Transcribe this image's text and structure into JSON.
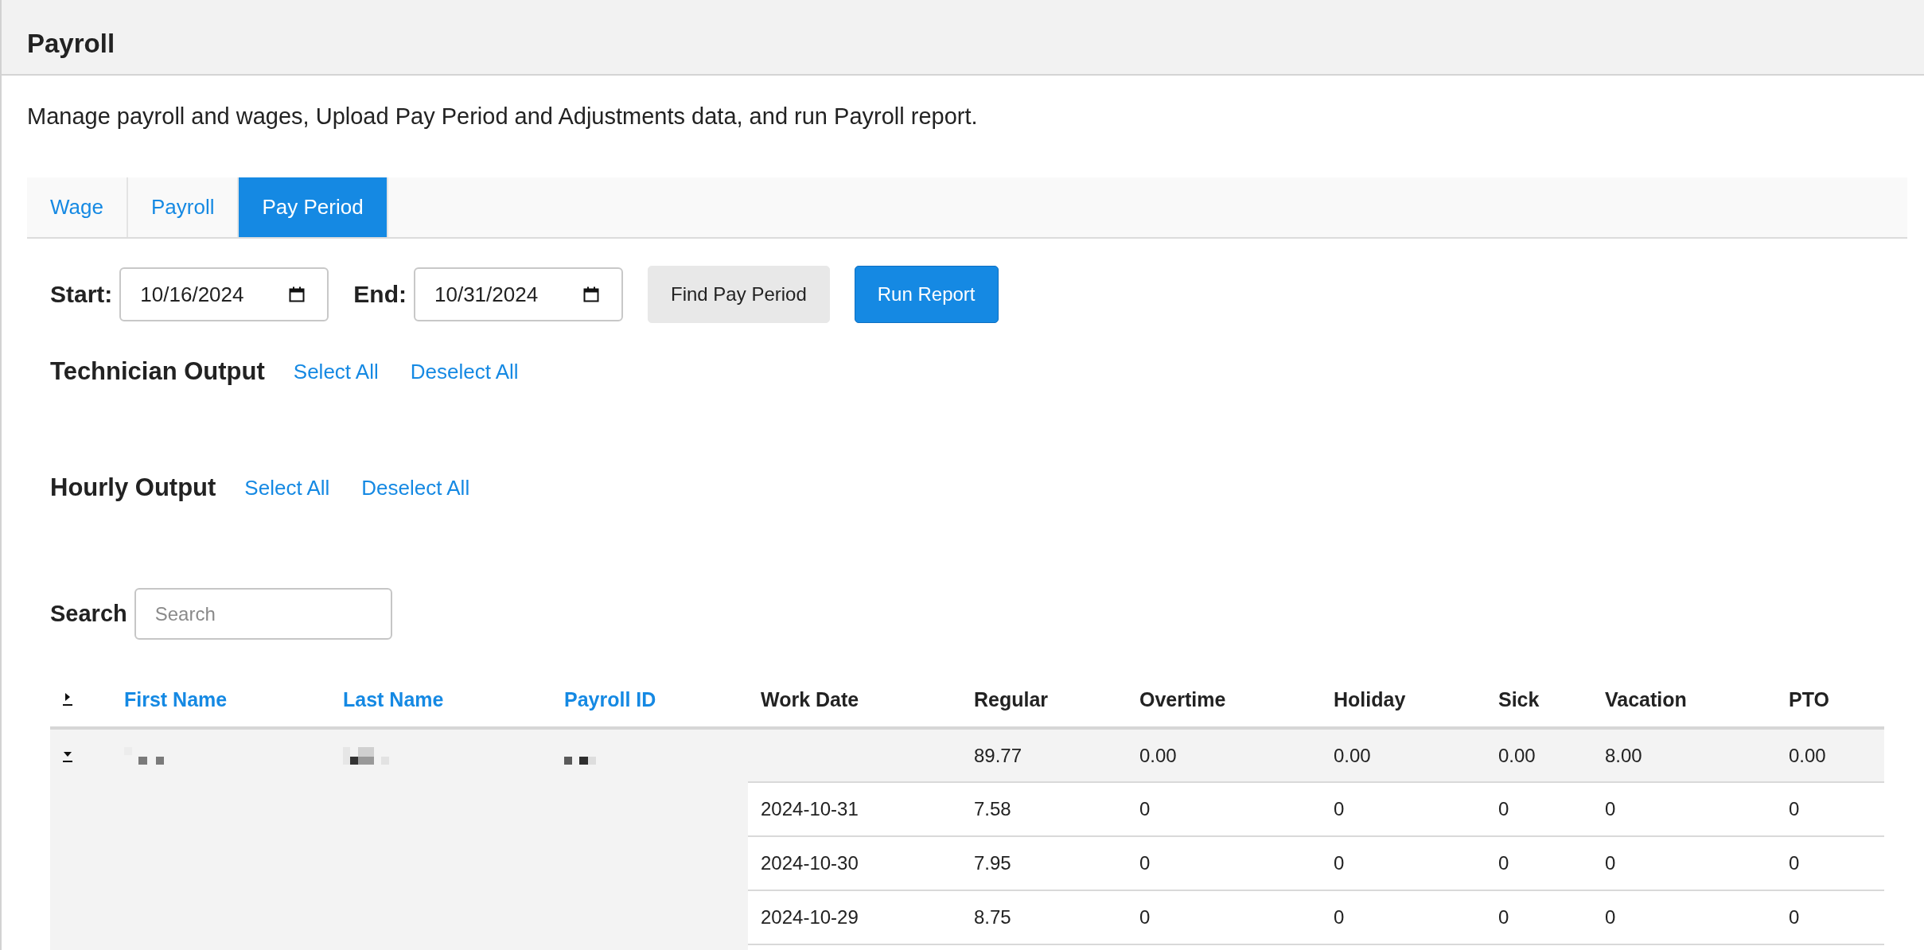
{
  "header": {
    "title": "Payroll"
  },
  "description": "Manage payroll and wages, Upload Pay Period and Adjustments data, and run Payroll report.",
  "tabs": [
    {
      "label": "Wage",
      "selected": false
    },
    {
      "label": "Payroll",
      "selected": false
    },
    {
      "label": "Pay Period",
      "selected": true
    }
  ],
  "filters": {
    "start": {
      "label": "Start:",
      "value": "10/16/2024"
    },
    "end": {
      "label": "End:",
      "value": "10/31/2024"
    },
    "buttons": [
      {
        "label": "Find Pay Period",
        "kind": "secondary"
      },
      {
        "label": "Run Report",
        "kind": "primary"
      }
    ]
  },
  "output_groups": [
    {
      "title": "Technician Output",
      "links": [
        "Select All",
        "Deselect All"
      ]
    },
    {
      "title": "Hourly Output",
      "links": [
        "Select All",
        "Deselect All"
      ]
    }
  ],
  "search": {
    "label": "Search",
    "placeholder": "Search"
  },
  "table": {
    "columns": [
      {
        "label": "First Name",
        "sortable": true
      },
      {
        "label": "Last Name",
        "sortable": true
      },
      {
        "label": "Payroll ID",
        "sortable": true
      },
      {
        "label": "Work Date",
        "sortable": false
      },
      {
        "label": "Regular",
        "sortable": false
      },
      {
        "label": "Overtime",
        "sortable": false
      },
      {
        "label": "Holiday",
        "sortable": false
      },
      {
        "label": "Sick",
        "sortable": false
      },
      {
        "label": "Vacation",
        "sortable": false
      },
      {
        "label": "PTO",
        "sortable": false
      }
    ],
    "rows": [
      {
        "expanded": true,
        "totals": [
          "89.77",
          "0.00",
          "0.00",
          "0.00",
          "8.00",
          "0.00"
        ],
        "details": [
          {
            "work_date": "2024-10-31",
            "hours": [
              "7.58",
              "0",
              "0",
              "0",
              "0",
              "0"
            ]
          },
          {
            "work_date": "2024-10-30",
            "hours": [
              "7.95",
              "0",
              "0",
              "0",
              "0",
              "0"
            ]
          },
          {
            "work_date": "2024-10-29",
            "hours": [
              "8.75",
              "0",
              "0",
              "0",
              "0",
              "0"
            ]
          }
        ]
      }
    ]
  }
}
